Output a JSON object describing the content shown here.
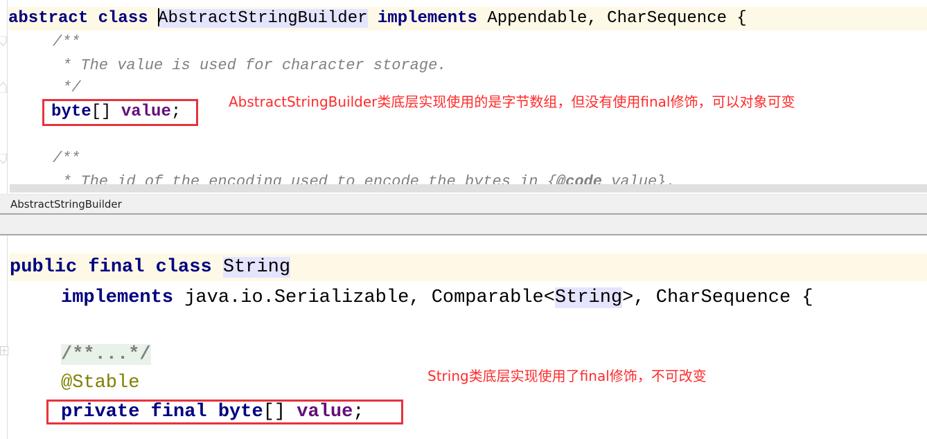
{
  "top_editor": {
    "lines": {
      "class_decl": {
        "kw_abstract": "abstract",
        "kw_class": "class",
        "class_name": "AbstractStringBuilder",
        "kw_implements": "implements",
        "interfaces": "Appendable, CharSequence {"
      },
      "doc1_open": "/**",
      "doc1_body": "* The value is used for character storage.",
      "doc1_close": "*/",
      "field_decl": {
        "type": "byte",
        "brackets": "[]",
        "name": "value",
        "semicolon": ";"
      },
      "doc2_open": "/**",
      "doc2_body_prefix": "* The id of the encoding used to encode the bytes in {",
      "doc2_tag": "@code",
      "doc2_body_suffix": " value}."
    },
    "annotation": "AbstractStringBuilder类底层实现使用的是字节数组，但没有使用final修饰，可以对象可变"
  },
  "breadcrumb": {
    "label": "AbstractStringBuilder"
  },
  "bottom_editor": {
    "lines": {
      "class_decl": {
        "kw_public": "public",
        "kw_final": "final",
        "kw_class": "class",
        "class_name": "String"
      },
      "implements_line": {
        "kw_implements": "implements",
        "serializable": "java.io.Serializable, Comparable<",
        "generic": "String",
        "rest": ">, CharSequence {"
      },
      "folded_doc": "/**...*/",
      "annotation_stable": "@Stable",
      "field_decl": {
        "kw_private": "private",
        "kw_final": "final",
        "type": "byte",
        "brackets": "[]",
        "name": "value",
        "semicolon": ";"
      }
    },
    "annotation": "String类底层实现使用了final修饰，不可改变"
  },
  "colors": {
    "keyword": "#000080",
    "field": "#660e7a",
    "comment": "#808080",
    "annotation": "#808000",
    "note_red": "#ff2a2a",
    "box_red": "#e8323a",
    "caret_row": "#fdf9e6",
    "identifier_highlight": "#e4e4ff"
  }
}
